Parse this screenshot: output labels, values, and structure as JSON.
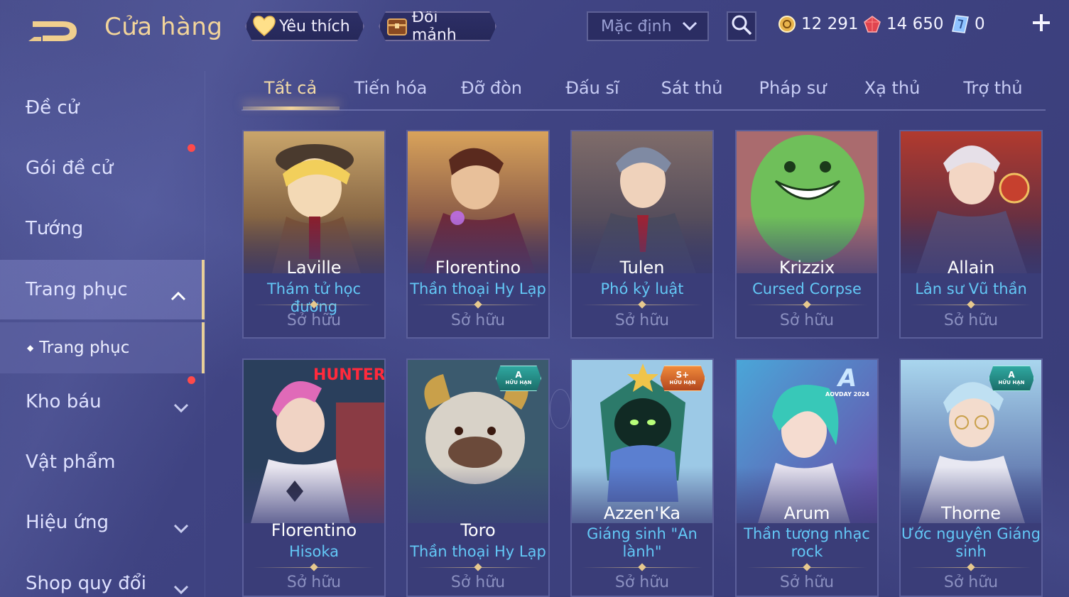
{
  "header": {
    "title": "Cửa hàng",
    "favorites_label": "Yêu thích",
    "shard_exchange_label": "Đổi mảnh",
    "sort_selected": "Mặc định",
    "currencies": {
      "gold": "12 291",
      "ruby": "14 650",
      "voucher": "0"
    }
  },
  "sidebar": {
    "items": [
      {
        "label": "Đề cử"
      },
      {
        "label": "Gói đề cử"
      },
      {
        "label": "Tướng"
      },
      {
        "label": "Trang phục"
      },
      {
        "label": "Trang phục"
      },
      {
        "label": "Kho báu"
      },
      {
        "label": "Vật phẩm"
      },
      {
        "label": "Hiệu ứng"
      },
      {
        "label": "Shop quy đổi"
      }
    ]
  },
  "tabs": [
    {
      "label": "Tất cả"
    },
    {
      "label": "Tiến hóa"
    },
    {
      "label": "Đỡ đòn"
    },
    {
      "label": "Đấu sĩ"
    },
    {
      "label": "Sát thủ"
    },
    {
      "label": "Pháp sư"
    },
    {
      "label": "Xạ thủ"
    },
    {
      "label": "Trợ thủ"
    }
  ],
  "skins": [
    {
      "hero": "Laville",
      "skin": "Thám tử học đường",
      "status": "Sở hữu"
    },
    {
      "hero": "Florentino",
      "skin": "Thần thoại Hy Lạp",
      "status": "Sở hữu"
    },
    {
      "hero": "Tulen",
      "skin": "Phó kỷ luật",
      "status": "Sở hữu"
    },
    {
      "hero": "Krizzix",
      "skin": "Cursed Corpse",
      "status": "Sở hữu"
    },
    {
      "hero": "Allain",
      "skin": "Lân sư Vũ thần",
      "status": "Sở hữu"
    },
    {
      "hero": "Florentino",
      "skin": "Hisoka",
      "status": "Sở hữu",
      "logo": "HUNTER"
    },
    {
      "hero": "Toro",
      "skin": "Thần thoại Hy Lạp",
      "status": "Sở hữu",
      "badge": "A",
      "badge_sub": "HỮU HẠN"
    },
    {
      "hero": "Azzen'Ka",
      "skin_line1": "Giáng sinh \"An",
      "skin_line2": "lành\"",
      "status": "Sở hữu",
      "badge": "S+",
      "badge_sub": "HỮU HẠN"
    },
    {
      "hero": "Arum",
      "skin_line1": "Thần tượng nhạc",
      "skin_line2": "rock",
      "status": "Sở hữu",
      "logo_a": "A",
      "logo_text": "AOVDAY 2024"
    },
    {
      "hero": "Thorne",
      "skin_line1": "Ước nguyện Giáng",
      "skin_line2": "sinh",
      "status": "Sở hữu",
      "badge": "A",
      "badge_sub": "HỮU HẠN"
    }
  ],
  "colors": {
    "accent_gold": "#f2d49a",
    "skin_name_blue": "#63c8f6",
    "owned_gray": "#8b90c0",
    "notification_red": "#ff4a4a"
  }
}
